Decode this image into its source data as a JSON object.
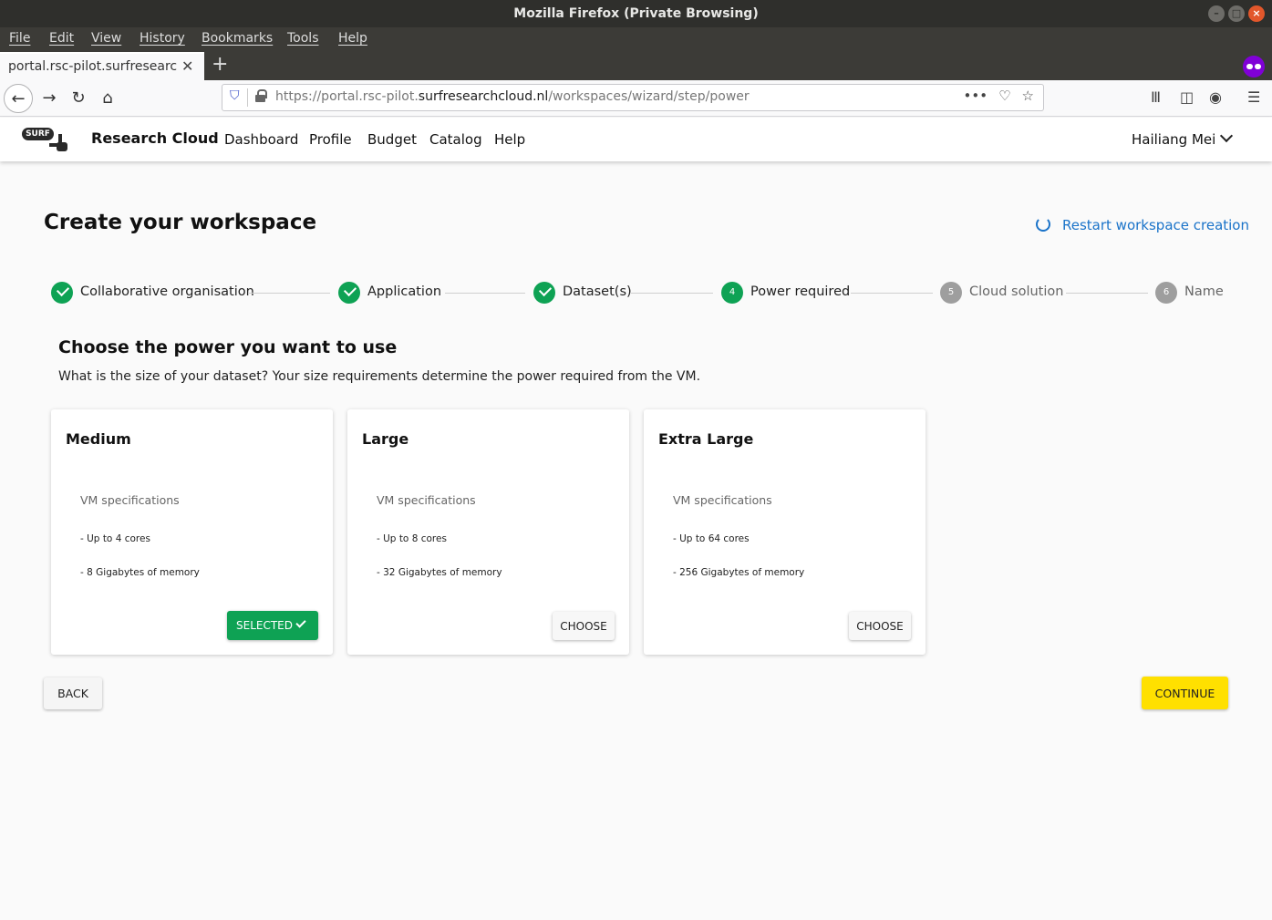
{
  "window": {
    "title": "Mozilla Firefox (Private Browsing)"
  },
  "menu": [
    "File",
    "Edit",
    "View",
    "History",
    "Bookmarks",
    "Tools",
    "Help"
  ],
  "tab": {
    "title": "portal.rsc-pilot.surfresearchcloud.nl"
  },
  "url": {
    "prefix": "https://portal.rsc-pilot.",
    "domain": "surfresearchcloud.nl",
    "path": "/workspaces/wizard/step/power"
  },
  "header": {
    "logo": "SURF",
    "brand": "Research Cloud",
    "nav": [
      "Dashboard",
      "Profile",
      "Budget",
      "Catalog",
      "Help"
    ],
    "user": "Hailiang Mei"
  },
  "page": {
    "title": "Create your workspace",
    "restart": "Restart workspace creation"
  },
  "steps": [
    {
      "label": "Collaborative organisation",
      "state": "done"
    },
    {
      "label": "Application",
      "state": "done"
    },
    {
      "label": "Dataset(s)",
      "state": "done"
    },
    {
      "number": "4",
      "label": "Power required",
      "state": "active"
    },
    {
      "number": "5",
      "label": "Cloud solution",
      "state": "todo"
    },
    {
      "number": "6",
      "label": "Name",
      "state": "todo"
    }
  ],
  "section": {
    "title": "Choose the power you want to use",
    "description": "What is the size of your dataset? Your size requirements determine the power required from the VM."
  },
  "cards": [
    {
      "title": "Medium",
      "spec": "VM specifications",
      "cores": "- Up to 4 cores",
      "memory": "- 8 Gigabytes of memory",
      "button": "SELECTED"
    },
    {
      "title": "Large",
      "spec": "VM specifications",
      "cores": "- Up to 8 cores",
      "memory": "- 32 Gigabytes of memory",
      "button": "CHOOSE"
    },
    {
      "title": "Extra Large",
      "spec": "VM specifications",
      "cores": "- Up to 64 cores",
      "memory": "- 256 Gigabytes of memory",
      "button": "CHOOSE"
    }
  ],
  "actions": {
    "back": "BACK",
    "continue": "CONTINUE"
  },
  "colors": {
    "accent_green": "#0ea254",
    "link_blue": "#1a73c9",
    "continue_yellow": "#ffe000"
  }
}
